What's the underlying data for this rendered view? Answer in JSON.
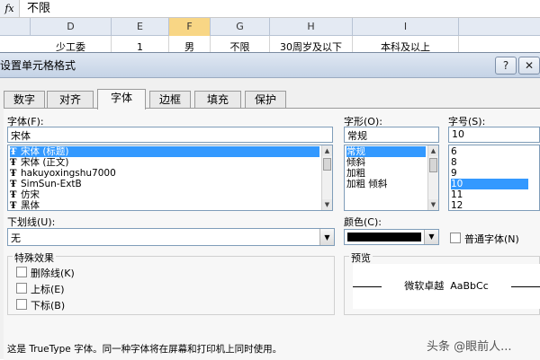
{
  "formula_bar": {
    "fx": "fx",
    "value": "不限"
  },
  "sheet": {
    "col_headers": [
      "D",
      "E",
      "F",
      "G",
      "H",
      "I"
    ],
    "row_cells": [
      "少工委",
      "1",
      "男",
      "不限",
      "30周岁及以下",
      "本科及以上"
    ]
  },
  "dialog": {
    "title": "设置单元格格式",
    "help_btn": "?",
    "close_btn": "✕",
    "tabs": [
      "数字",
      "对齐",
      "字体",
      "边框",
      "填充",
      "保护"
    ],
    "font": {
      "label": "字体(F):",
      "value": "宋体",
      "items": [
        "宋体 (标题)",
        "宋体 (正文)",
        "hakuyoxingshu7000",
        "SimSun-ExtB",
        "仿宋",
        "黑体"
      ]
    },
    "style": {
      "label": "字形(O):",
      "value": "常规",
      "items": [
        "常规",
        "倾斜",
        "加粗",
        "加粗 倾斜"
      ]
    },
    "size": {
      "label": "字号(S):",
      "value": "10",
      "items": [
        "6",
        "8",
        "9",
        "10",
        "11",
        "12"
      ]
    },
    "underline": {
      "label": "下划线(U):",
      "value": "无"
    },
    "color": {
      "label": "颜色(C):",
      "swatch": "#000000"
    },
    "normal_font": {
      "label": "普通字体(N)",
      "checked": false
    },
    "effects": {
      "label": "特殊效果",
      "strikethrough": "删除线(K)",
      "superscript": "上标(E)",
      "subscript": "下标(B)"
    },
    "preview": {
      "label": "预览",
      "text": "微软卓越  AaBbCc"
    },
    "note": "这是 TrueType 字体。同一种字体将在屏幕和打印机上同时使用。",
    "watermark": "头条 @眼前人..."
  },
  "colors": {
    "selection": "#3399ff",
    "title_gradient_top": "#dfe7f2",
    "selected_col": "#f8d685"
  }
}
